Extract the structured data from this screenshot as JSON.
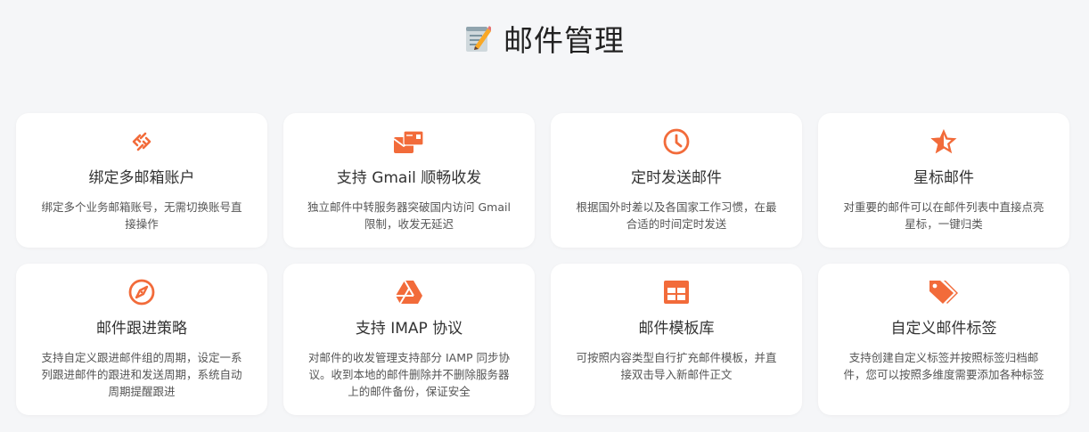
{
  "page": {
    "title": "邮件管理",
    "title_icon": "memo-pencil-icon",
    "accent_color": "#f26b3a"
  },
  "features": [
    {
      "icon": "link-chain-icon",
      "title": "绑定多邮箱账户",
      "desc": "绑定多个业务邮箱账号，无需切换账号直接操作"
    },
    {
      "icon": "mail-envelopes-icon",
      "title": "支持 Gmail 顺畅收发",
      "desc": "独立邮件中转服务器突破国内访问 Gmail 限制，收发无延迟"
    },
    {
      "icon": "clock-icon",
      "title": "定时发送邮件",
      "desc": "根据国外时差以及各国家工作习惯，在最合适的时间定时发送"
    },
    {
      "icon": "star-icon",
      "title": "星标邮件",
      "desc": "对重要的邮件可以在邮件列表中直接点亮星标，一键归类"
    },
    {
      "icon": "compass-icon",
      "title": "邮件跟进策略",
      "desc": "支持自定义跟进邮件组的周期，设定一系列跟进邮件的跟进和发送周期，系统自动周期提醒跟进"
    },
    {
      "icon": "drive-triangle-icon",
      "title": "支持 IMAP 协议",
      "desc": "对邮件的收发管理支持部分 IAMP 同步协议。收到本地的邮件删除并不删除服务器上的邮件备份，保证安全"
    },
    {
      "icon": "table-grid-icon",
      "title": "邮件模板库",
      "desc": "可按照内容类型自行扩充邮件模板，并直接双击导入新邮件正文"
    },
    {
      "icon": "tags-icon",
      "title": "自定义邮件标签",
      "desc": "支持创建自定义标签并按照标签归档邮件，您可以按照多维度需要添加各种标签"
    }
  ]
}
